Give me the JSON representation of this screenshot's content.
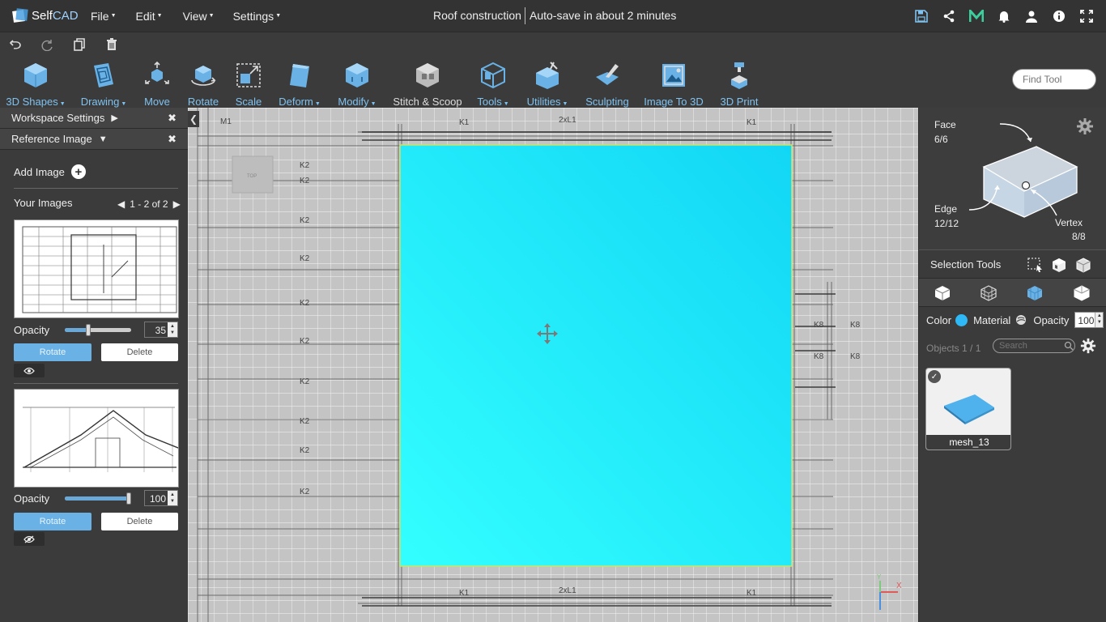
{
  "app": {
    "logo_prefix": "Self",
    "logo_suffix": "CAD",
    "menus": [
      "File",
      "Edit",
      "View",
      "Settings"
    ],
    "doc_title": "Roof construction",
    "autosave": "Auto-save in about 2 minutes",
    "top_icons": [
      "save-icon",
      "share-icon",
      "m-logo-icon",
      "bell-icon",
      "user-icon",
      "info-icon",
      "fullscreen-icon"
    ],
    "accent": "#6ab2e6"
  },
  "actions": [
    "undo-icon",
    "redo-icon",
    "copy-icon",
    "delete-icon"
  ],
  "toolbar": {
    "tools": [
      {
        "id": "3d-shapes",
        "label": "3D Shapes",
        "dropdown": true
      },
      {
        "id": "drawing",
        "label": "Drawing",
        "dropdown": true
      },
      {
        "id": "move",
        "label": "Move",
        "dropdown": false
      },
      {
        "id": "rotate",
        "label": "Rotate",
        "dropdown": false
      },
      {
        "id": "scale",
        "label": "Scale",
        "dropdown": false
      },
      {
        "id": "deform",
        "label": "Deform",
        "dropdown": true
      },
      {
        "id": "modify",
        "label": "Modify",
        "dropdown": true
      },
      {
        "id": "stitch-scoop",
        "label": "Stitch & Scoop",
        "dropdown": false
      },
      {
        "id": "tools",
        "label": "Tools",
        "dropdown": true
      },
      {
        "id": "utilities",
        "label": "Utilities",
        "dropdown": true
      },
      {
        "id": "sculpting",
        "label": "Sculpting",
        "dropdown": false
      },
      {
        "id": "image-to-3d",
        "label": "Image To 3D",
        "dropdown": false
      },
      {
        "id": "3d-print",
        "label": "3D Print",
        "dropdown": false
      }
    ],
    "find_placeholder": "Find Tool"
  },
  "left_panel": {
    "workspace_settings": "Workspace Settings",
    "reference_image": "Reference Image",
    "add_image": "Add Image",
    "your_images": "Your Images",
    "pager": "1 - 2 of 2",
    "images": [
      {
        "opacity_label": "Opacity",
        "opacity": "35",
        "opacity_fraction": 0.35,
        "rotate": "Rotate",
        "delete": "Delete",
        "visible": true
      },
      {
        "opacity_label": "Opacity",
        "opacity": "100",
        "opacity_fraction": 1.0,
        "rotate": "Rotate",
        "delete": "Delete",
        "visible": false
      }
    ]
  },
  "viewport": {
    "plane_color": "#1fe0ff",
    "labels": [
      "M1",
      "K1",
      "2xL1",
      "K1",
      "K2",
      "K2",
      "K2",
      "K2",
      "K2",
      "K2",
      "K2",
      "K2",
      "K2",
      "K2",
      "K8",
      "K8",
      "K8",
      "K8",
      "K1",
      "2xL1",
      "K1"
    ],
    "view_cube_label": "TOP",
    "axes": {
      "x": "X",
      "y": "Y"
    }
  },
  "right_panel": {
    "face_label": "Face",
    "face_count": "6/6",
    "edge_label": "Edge",
    "edge_count": "12/12",
    "vertex_label": "Vertex",
    "vertex_count": "8/8",
    "selection_tools": "Selection Tools",
    "color_label": "Color",
    "material_label": "Material",
    "opacity_label": "Opacity",
    "opacity_value": "100",
    "objects_count": "Objects 1 / 1",
    "search_placeholder": "Search",
    "object_name": "mesh_13"
  }
}
